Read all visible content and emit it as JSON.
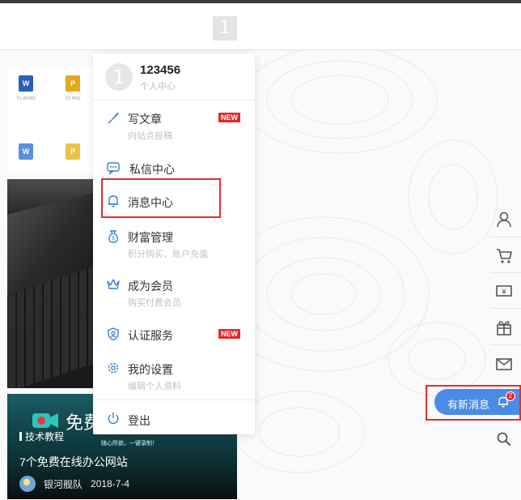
{
  "header": {
    "avatar_glyph": "1"
  },
  "user": {
    "name": "123456",
    "subtitle": "个人中心",
    "avatar_glyph": "1"
  },
  "menu": {
    "items": [
      {
        "label": "写文章",
        "sub": "向站点投稿",
        "badge": "NEW",
        "icon": "pen-icon"
      },
      {
        "label": "私信中心",
        "sub": "",
        "badge": "",
        "icon": "chat-icon"
      },
      {
        "label": "消息中心",
        "sub": "",
        "badge": "",
        "icon": "bell-icon"
      },
      {
        "label": "财富管理",
        "sub": "积分购买、账户充值",
        "badge": "",
        "icon": "money-bag-icon"
      },
      {
        "label": "成为会员",
        "sub": "购买付费会员",
        "badge": "",
        "icon": "crown-icon"
      },
      {
        "label": "认证服务",
        "sub": "",
        "badge": "NEW",
        "icon": "shield-icon"
      },
      {
        "label": "我的设置",
        "sub": "编辑个人资料",
        "badge": "",
        "icon": "gear-icon"
      }
    ],
    "logout": {
      "label": "登出",
      "icon": "power-icon"
    }
  },
  "card": {
    "tag": "技术教程",
    "title": "7个免费在线办公网站",
    "author": "银河舰队",
    "date": "2018-7-4",
    "banner_text": "免费",
    "banner_sub": "随心所欲，一键录制！"
  },
  "notify": {
    "label": "有新消息",
    "count": "2"
  },
  "colors": {
    "accent": "#4a8be8",
    "badge": "#e4262c",
    "highlight": "#e0302e"
  }
}
